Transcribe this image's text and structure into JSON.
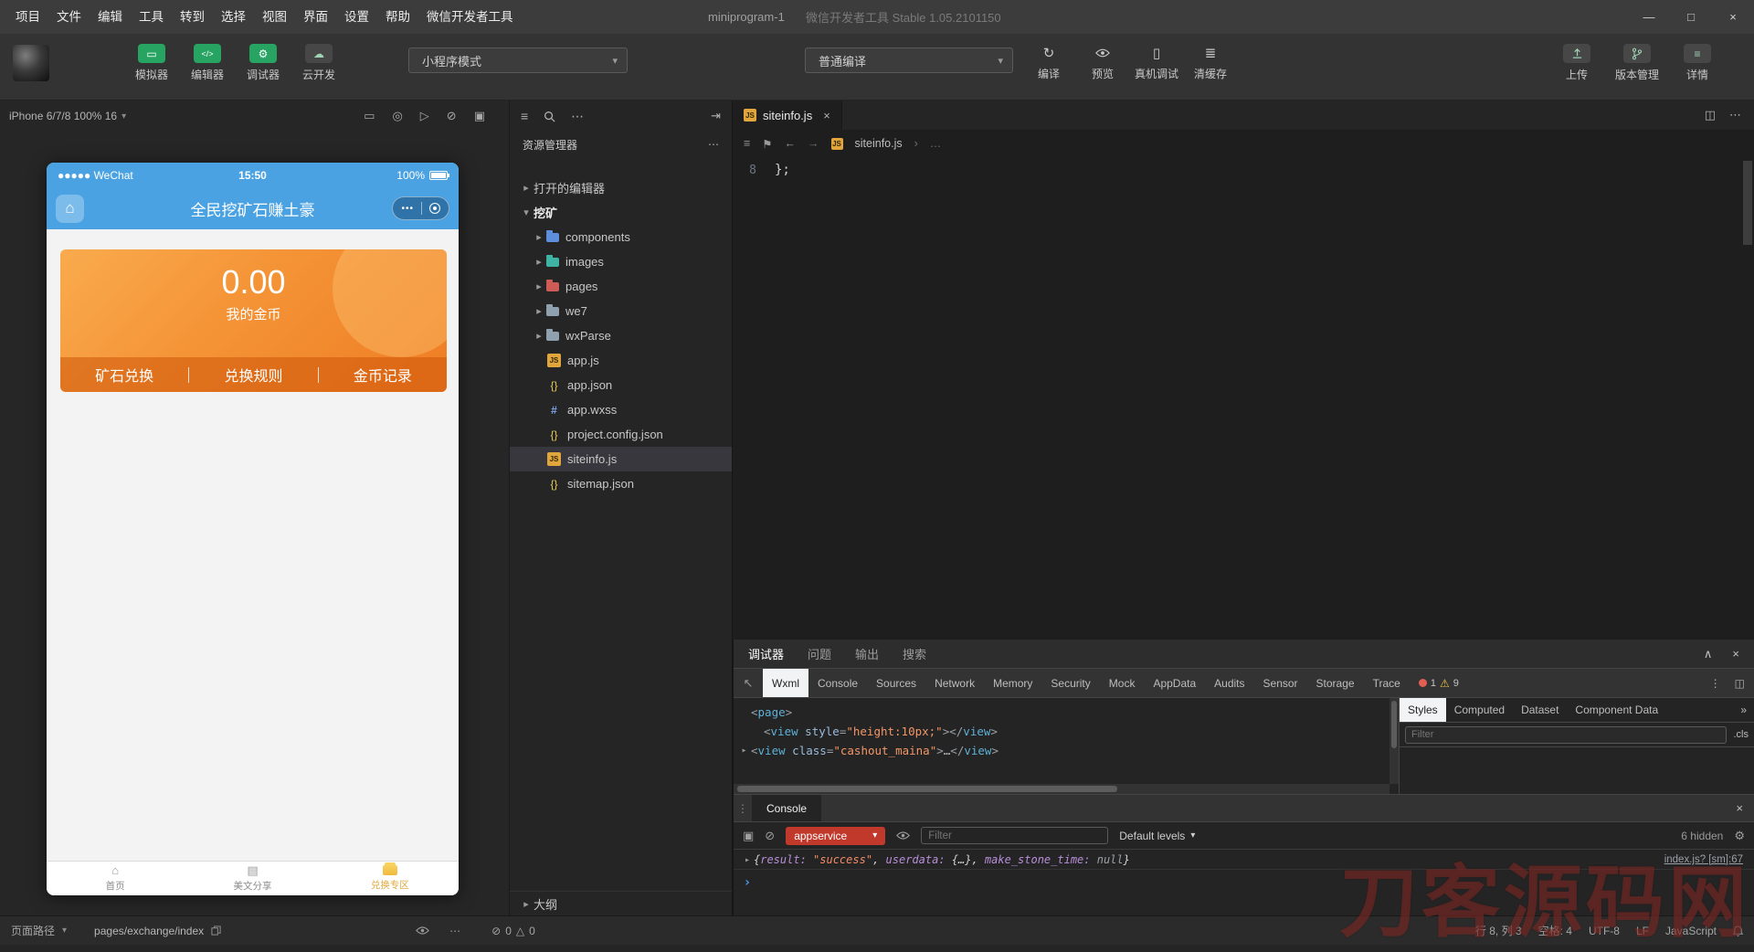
{
  "titlebar": {
    "menus": [
      "项目",
      "文件",
      "编辑",
      "工具",
      "转到",
      "选择",
      "视图",
      "界面",
      "设置",
      "帮助",
      "微信开发者工具"
    ],
    "project_name": "miniprogram-1",
    "app_title": "微信开发者工具 Stable 1.05.2101150"
  },
  "toolbar": {
    "simulator": "模拟器",
    "editor": "编辑器",
    "debugger": "调试器",
    "cloud": "云开发",
    "mode_select": "小程序模式",
    "compile_select": "普通编译",
    "compile": "编译",
    "preview": "预览",
    "device_debug": "真机调试",
    "clear_cache": "清缓存",
    "upload": "上传",
    "version": "版本管理",
    "details": "详情"
  },
  "simulator": {
    "device_label": "iPhone 6/7/8 100% 16",
    "phone": {
      "carrier": "●●●●● WeChat",
      "time": "15:50",
      "battery": "100%",
      "nav_title": "全民挖矿石赚土豪",
      "card": {
        "amount": "0.00",
        "caption": "我的金币",
        "action1": "矿石兑换",
        "action2": "兑换规则",
        "action3": "金币记录"
      },
      "tab1": "首页",
      "tab2": "美文分享",
      "tab3": "兑换专区"
    }
  },
  "explorer": {
    "title": "资源管理器",
    "tree": [
      {
        "label": "打开的编辑器"
      },
      {
        "label": "挖矿"
      },
      {
        "label": "components"
      },
      {
        "label": "images"
      },
      {
        "label": "pages"
      },
      {
        "label": "we7"
      },
      {
        "label": "wxParse"
      },
      {
        "label": "app.js"
      },
      {
        "label": "app.json"
      },
      {
        "label": "app.wxss"
      },
      {
        "label": "project.config.json"
      },
      {
        "label": "siteinfo.js"
      },
      {
        "label": "sitemap.json"
      }
    ],
    "outline": "大纲"
  },
  "editor": {
    "tab": "siteinfo.js",
    "breadcrumb_file": "siteinfo.js",
    "breadcrumb_more": "…",
    "line_number": "8",
    "code": "};"
  },
  "devtools": {
    "drawer_tabs": [
      "调试器",
      "问题",
      "输出",
      "搜索"
    ],
    "tabs": [
      "Wxml",
      "Console",
      "Sources",
      "Network",
      "Memory",
      "Security",
      "Mock",
      "AppData",
      "Audits",
      "Sensor",
      "Storage",
      "Trace"
    ],
    "error_count": "1",
    "warning_count": "9",
    "wxml": {
      "l1_o": "<",
      "l1_tag": "page",
      "l1_c": ">",
      "l2_o": "<",
      "l2_tag": "view",
      "l2_attr": "style",
      "l2_eq": "=",
      "l2_val": "\"height:10px;\"",
      "l2_c": ">",
      "l2_o2": "</",
      "l2_tag2": "view",
      "l2_c2": ">",
      "l3_o": "<",
      "l3_tag": "view",
      "l3_attr": "class",
      "l3_eq": "=",
      "l3_val": "\"cashout_maina\"",
      "l3_c": ">",
      "l3_dots": "…",
      "l3_o2": "</",
      "l3_tag2": "view",
      "l3_c2": ">"
    },
    "styles_tabs": [
      "Styles",
      "Computed",
      "Dataset",
      "Component Data"
    ],
    "styles_more": "»",
    "filter_placeholder": "Filter",
    "cls": ".cls"
  },
  "console": {
    "tab": "Console",
    "context": "appservice",
    "filter_placeholder": "Filter",
    "levels": "Default levels",
    "hidden": "6 hidden",
    "log": {
      "brace_o": "{",
      "p1": "result: ",
      "v1": "\"success\"",
      "s1": ", ",
      "p2": "userdata: ",
      "v2": "{…}",
      "s2": ", ",
      "p3": "make_stone_time: ",
      "v3": "null",
      "brace_c": "}",
      "source_link": "index.js? [sm]:67"
    }
  },
  "statusbar": {
    "page_path_label": "页面路径",
    "page_path": "pages/exchange/index",
    "error_count": "0",
    "warning_count": "0",
    "cursor": "行 8, 列 3",
    "indent": "空格: 4",
    "encoding": "UTF-8",
    "eol": "LF",
    "language": "JavaScript"
  },
  "watermark": "刀客源码网"
}
